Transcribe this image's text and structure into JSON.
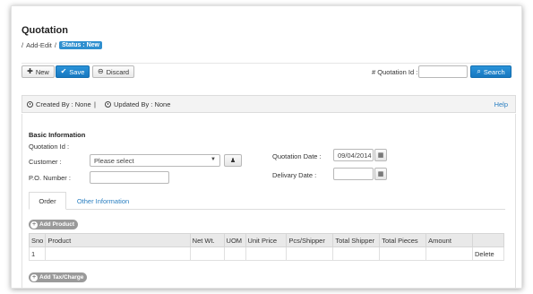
{
  "page": {
    "title": "Quotation"
  },
  "breadcrumb": {
    "sep1": "/",
    "item": "Add-Edit",
    "sep2": "/",
    "status": "Status : New"
  },
  "toolbar": {
    "new_label": "New",
    "save_label": "Save",
    "discard_label": "Discard"
  },
  "search_bar": {
    "quotation_id_label": "# Quotation Id :",
    "quotation_id_value": "",
    "search_label": "Search"
  },
  "info_bar": {
    "created_by": "Created By : None",
    "separator": "|",
    "updated_by": "Updated By : None",
    "help": "Help"
  },
  "form": {
    "section_title": "Basic Information",
    "quotation_id_label": "Quotation Id :",
    "customer_label": "Customer :",
    "customer_value": "Please select",
    "po_label": "P.O. Number :",
    "po_value": "",
    "quotation_date_label": "Quotation Date :",
    "quotation_date_value": "09/04/2014",
    "delivery_date_label": "Delivary Date :",
    "delivery_date_value": ""
  },
  "tabs": [
    {
      "label": "Order"
    },
    {
      "label": "Other Information"
    }
  ],
  "add_product_label": "Add Product",
  "add_tax_label": "Add Tax/Charge",
  "table": {
    "headers": [
      "Sno",
      "Product",
      "Net Wt.",
      "UOM",
      "Unit Price",
      "Pcs/Shipper",
      "Total Shipper",
      "Total Pieces",
      "Amount",
      ""
    ],
    "rows": [
      {
        "sno": "1",
        "product": "",
        "net_wt": "",
        "uom": "",
        "unit_price": "",
        "pcs_shipper": "",
        "total_shipper": "",
        "total_pieces": "",
        "amount": "",
        "action": "Delete"
      }
    ]
  },
  "icons": [
    "plus-icon",
    "check-icon",
    "discard-icon",
    "search-icon",
    "clock-icon",
    "calendar-icon",
    "person-icon"
  ],
  "colors": {
    "primary": "#1f86cc",
    "link": "#2a7fc1",
    "badge": "#2f8fcf"
  }
}
